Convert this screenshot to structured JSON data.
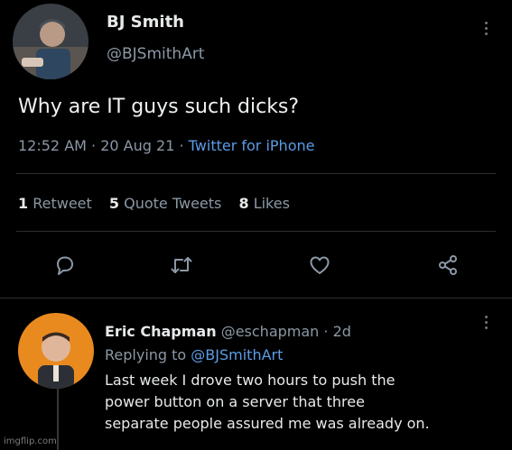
{
  "tweet": {
    "author_name": "BJ Smith",
    "author_handle": "@BJSmithArt",
    "text": "Why are IT guys such dicks?",
    "time": "12:52 AM",
    "separator": "·",
    "date": "20 Aug 21",
    "source": "Twitter for iPhone",
    "stats": {
      "retweets_count": "1",
      "retweets_label": "Retweet",
      "quotes_count": "5",
      "quotes_label": "Quote Tweets",
      "likes_count": "8",
      "likes_label": "Likes"
    },
    "actions": [
      "reply-icon",
      "retweet-icon",
      "like-icon",
      "share-icon"
    ]
  },
  "reply": {
    "author_name": "Eric Chapman",
    "author_handle": "@eschapman",
    "separator": "·",
    "age": "2d",
    "replying_prefix": "Replying to",
    "replying_to": "@BJSmithArt",
    "lines": [
      "Last week I drove two hours to push the",
      "power button on a server that three",
      "separate people assured me was already on."
    ]
  },
  "watermark": "imgflip.com",
  "colors": {
    "background": "#000000",
    "text": "#e7e9ea",
    "muted": "#8b98a5",
    "link": "#5c9ce6",
    "divider": "#2b2f33"
  }
}
